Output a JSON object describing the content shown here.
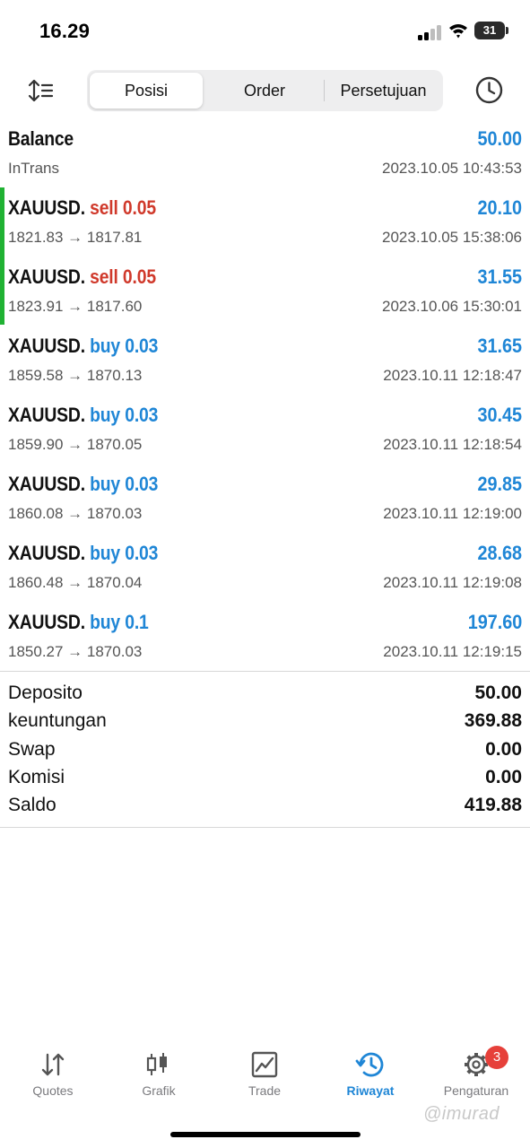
{
  "status_bar": {
    "time": "16.29",
    "battery": "31"
  },
  "toolbar": {
    "tabs": [
      {
        "label": "Posisi",
        "active": true
      },
      {
        "label": "Order",
        "active": false
      },
      {
        "label": "Persetujuan",
        "active": false
      }
    ],
    "sort_icon": "sort-icon",
    "history_icon": "clock-icon"
  },
  "balance": {
    "title": "Balance",
    "amount": "50.00",
    "subtitle": "InTrans",
    "time": "2023.10.05 10:43:53"
  },
  "trades": [
    {
      "symbol": "XAUUSD.",
      "side": "sell",
      "volume": "0.05",
      "prices": "1821.83 → 1817.81",
      "profit": "20.10",
      "time": "2023.10.05 15:38:06"
    },
    {
      "symbol": "XAUUSD.",
      "side": "sell",
      "volume": "0.05",
      "prices": "1823.91 → 1817.60",
      "profit": "31.55",
      "time": "2023.10.06 15:30:01"
    },
    {
      "symbol": "XAUUSD.",
      "side": "buy",
      "volume": "0.03",
      "prices": "1859.58 → 1870.13",
      "profit": "31.65",
      "time": "2023.10.11 12:18:47"
    },
    {
      "symbol": "XAUUSD.",
      "side": "buy",
      "volume": "0.03",
      "prices": "1859.90 → 1870.05",
      "profit": "30.45",
      "time": "2023.10.11 12:18:54"
    },
    {
      "symbol": "XAUUSD.",
      "side": "buy",
      "volume": "0.03",
      "prices": "1860.08 → 1870.03",
      "profit": "29.85",
      "time": "2023.10.11 12:19:00"
    },
    {
      "symbol": "XAUUSD.",
      "side": "buy",
      "volume": "0.03",
      "prices": "1860.48 → 1870.04",
      "profit": "28.68",
      "time": "2023.10.11 12:19:08"
    },
    {
      "symbol": "XAUUSD.",
      "side": "buy",
      "volume": "0.1",
      "prices": "1850.27 → 1870.03",
      "profit": "197.60",
      "time": "2023.10.11 12:19:15"
    }
  ],
  "summary": [
    {
      "label": "Deposito",
      "value": "50.00"
    },
    {
      "label": "keuntungan",
      "value": "369.88"
    },
    {
      "label": "Swap",
      "value": "0.00"
    },
    {
      "label": "Komisi",
      "value": "0.00"
    },
    {
      "label": "Saldo",
      "value": "419.88"
    }
  ],
  "tabbar": {
    "items": [
      {
        "label": "Quotes",
        "icon": "quotes-arrows-icon",
        "active": false
      },
      {
        "label": "Grafik",
        "icon": "candlestick-icon",
        "active": false
      },
      {
        "label": "Trade",
        "icon": "trade-chart-icon",
        "active": false
      },
      {
        "label": "Riwayat",
        "icon": "history-clock-icon",
        "active": true
      },
      {
        "label": "Pengaturan",
        "icon": "gear-icon",
        "active": false
      }
    ],
    "settings_badge": "3"
  },
  "watermark": "@imurad",
  "colors": {
    "accent_blue": "#1f86d6",
    "sell_red": "#d0392b",
    "highlight_green": "#20b233",
    "badge_red": "#e6403a"
  }
}
